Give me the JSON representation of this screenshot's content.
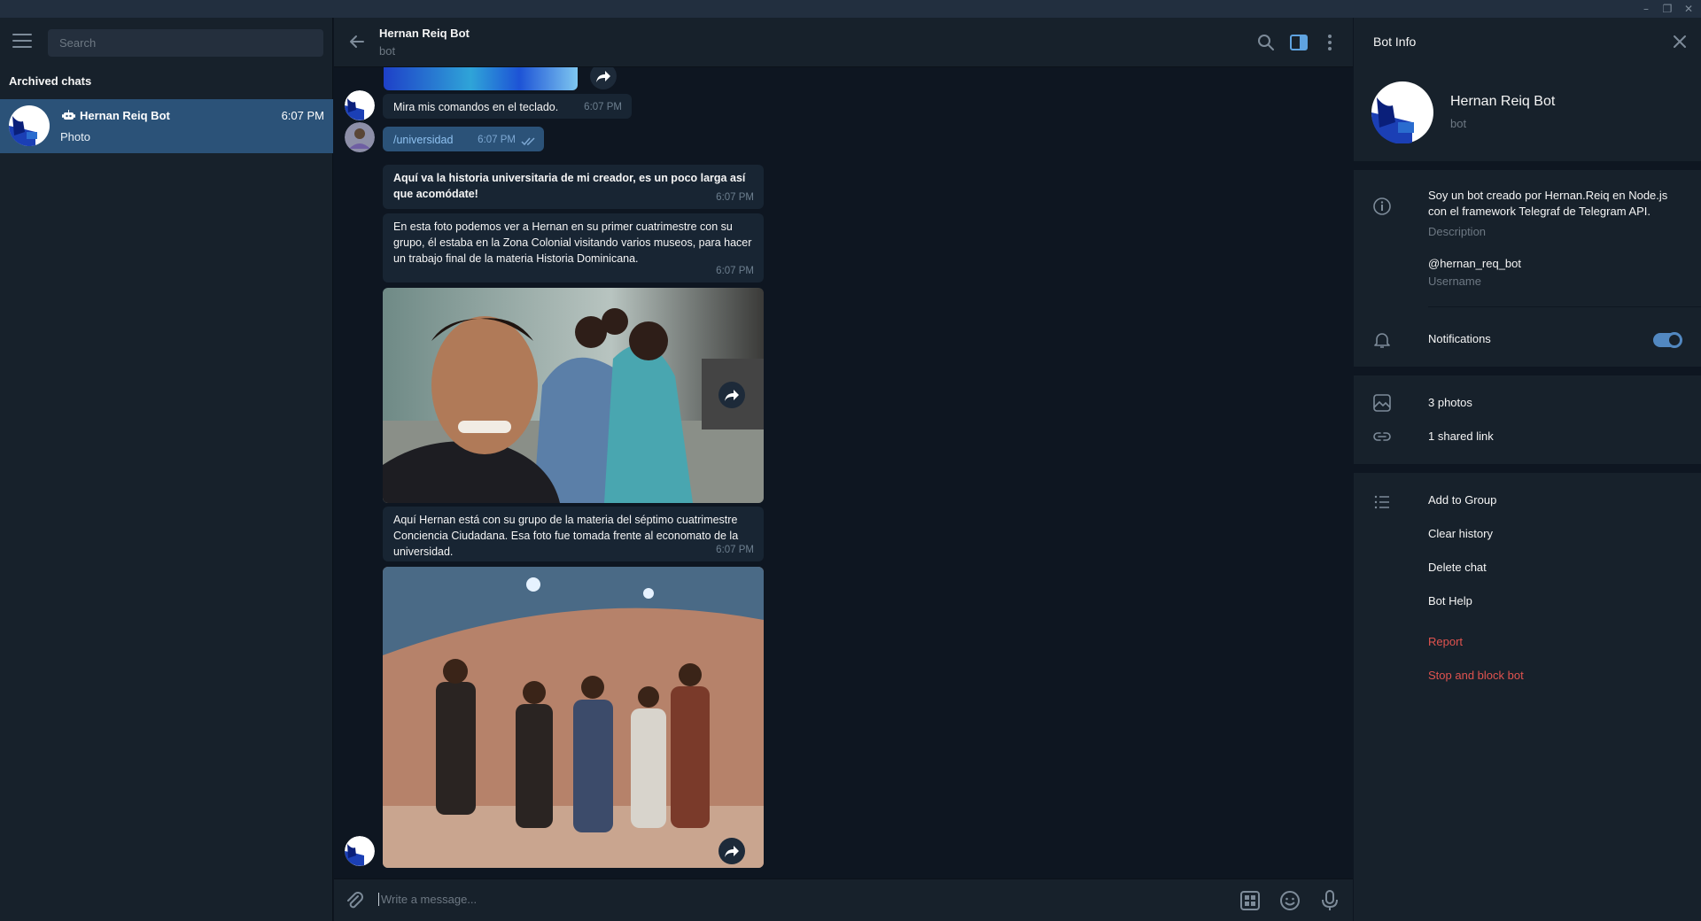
{
  "sidebar": {
    "search_placeholder": "Search",
    "section_title": "Archived chats",
    "chat": {
      "name": "Hernan Reiq Bot",
      "time": "6:07 PM",
      "preview": "Photo"
    }
  },
  "header": {
    "name": "Hernan Reiq Bot",
    "status": "bot"
  },
  "messages": {
    "m1": {
      "text": "Mira mis comandos en el teclado.",
      "time": "6:07 PM"
    },
    "m2": {
      "text": "/universidad",
      "time": "6:07 PM"
    },
    "m3": {
      "text": "Aquí va la historia universitaria de mi creador, es un poco larga así que acomódate!",
      "time": "6:07 PM"
    },
    "m4": {
      "text": "En esta foto podemos ver a Hernan en su primer cuatrimestre con su grupo, él estaba en la Zona Colonial visitando varios museos, para hacer un trabajo final de la materia Historia Dominicana.",
      "time": "6:07 PM"
    },
    "m5": {
      "text": "Aquí Hernan está con su grupo de la materia del séptimo cuatrimestre Conciencia Ciudadana. Esa foto fue tomada frente al economato de la universidad.",
      "time": "6:07 PM"
    }
  },
  "composer": {
    "placeholder": "Write a message..."
  },
  "info": {
    "title": "Bot Info",
    "name": "Hernan Reiq Bot",
    "status": "bot",
    "description": "Soy un bot creado por Hernan.Reiq en Node.js con el framework Telegraf de Telegram API.",
    "description_label": "Description",
    "username": "@hernan_req_bot",
    "username_label": "Username",
    "notifications": "Notifications",
    "notifications_on": true,
    "photos": "3 photos",
    "links": "1 shared link",
    "add_to_group": "Add to Group",
    "clear_history": "Clear history",
    "delete_chat": "Delete chat",
    "bot_help": "Bot Help",
    "report": "Report",
    "stop_block": "Stop and block bot"
  },
  "colors": {
    "accent": "#5288c1",
    "selected": "#2b5278",
    "danger": "#e0534f",
    "bg": "#0e1621",
    "panel": "#17212b"
  }
}
